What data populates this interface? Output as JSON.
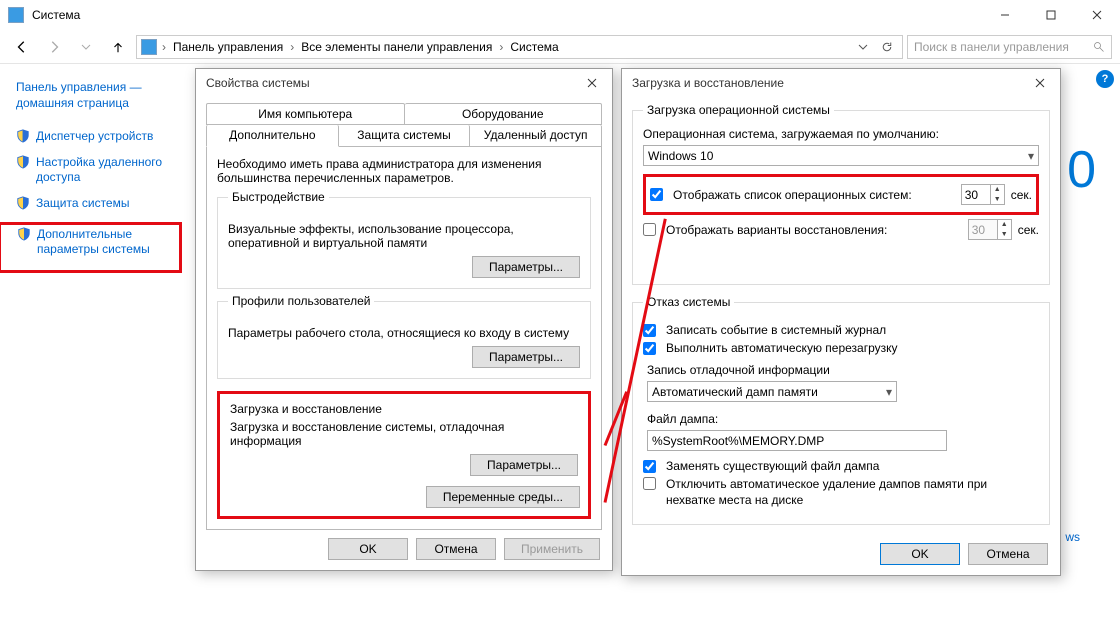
{
  "window": {
    "title": "Система",
    "breadcrumbs": [
      "Панель управления",
      "Все элементы панели управления",
      "Система"
    ],
    "search_placeholder": "Поиск в панели управления",
    "help_badge": "?"
  },
  "side": {
    "home": "Панель управления — домашняя страница",
    "items": [
      {
        "label": "Диспетчер устройств"
      },
      {
        "label": "Настройка удаленного доступа"
      },
      {
        "label": "Защита системы"
      },
      {
        "label": "Дополнительные параметры системы"
      }
    ]
  },
  "bg": {
    "zero": "0",
    "ws": "ws"
  },
  "dlg1": {
    "title": "Свойства системы",
    "tabs_top": [
      "Имя компьютера",
      "Оборудование"
    ],
    "tabs_bot": [
      "Дополнительно",
      "Защита системы",
      "Удаленный доступ"
    ],
    "note": "Необходимо иметь права администратора для изменения большинства перечисленных параметров.",
    "perf": {
      "legend": "Быстродействие",
      "text": "Визуальные эффекты, использование процессора, оперативной и виртуальной памяти",
      "btn": "Параметры..."
    },
    "profiles": {
      "legend": "Профили пользователей",
      "text": "Параметры рабочего стола, относящиеся ко входу в систему",
      "btn": "Параметры..."
    },
    "startup": {
      "legend": "Загрузка и восстановление",
      "text": "Загрузка и восстановление системы, отладочная информация",
      "btn": "Параметры..."
    },
    "envvars_btn": "Переменные среды...",
    "ok": "OK",
    "cancel": "Отмена",
    "apply": "Применить"
  },
  "dlg2": {
    "title": "Загрузка и восстановление",
    "boot": {
      "legend": "Загрузка операционной системы",
      "default_label": "Операционная система, загружаемая по умолчанию:",
      "default_value": "Windows 10",
      "show_os_list": "Отображать список операционных систем:",
      "show_os_secs": "30",
      "show_recovery": "Отображать варианты восстановления:",
      "show_recovery_secs": "30",
      "sec": "сек."
    },
    "fail": {
      "legend": "Отказ системы",
      "log_event": "Записать событие в системный журнал",
      "auto_restart": "Выполнить автоматическую перезагрузку",
      "dump_legend": "Запись отладочной информации",
      "dump_type": "Автоматический дамп памяти",
      "dump_file_label": "Файл дампа:",
      "dump_file_value": "%SystemRoot%\\MEMORY.DMP",
      "overwrite": "Заменять существующий файл дампа",
      "no_autodel": "Отключить автоматическое удаление дампов памяти при нехватке места на диске"
    },
    "ok": "OK",
    "cancel": "Отмена"
  }
}
